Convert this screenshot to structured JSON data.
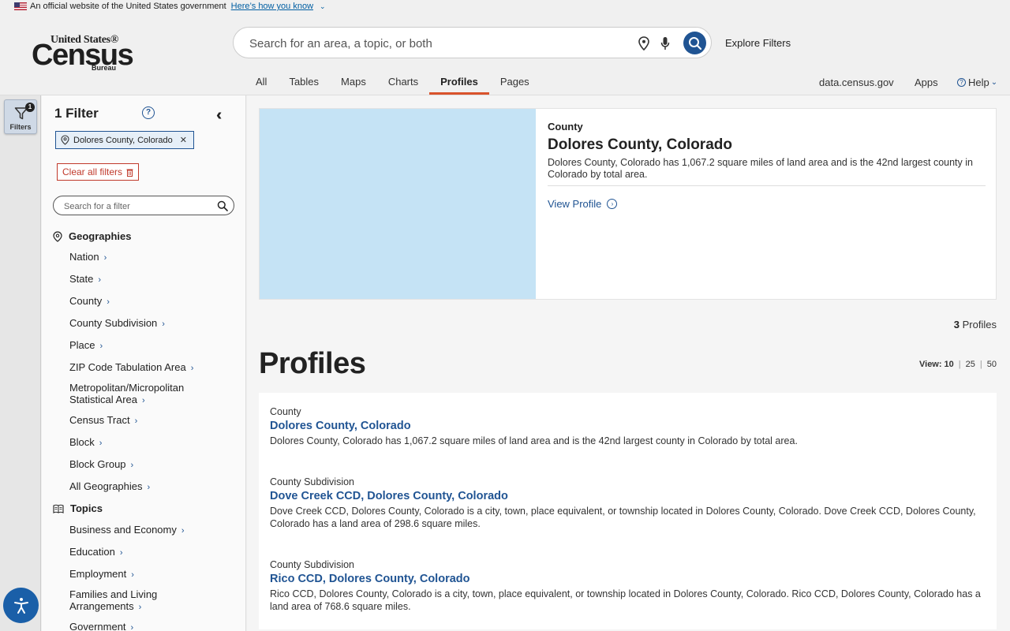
{
  "gov_banner": {
    "text": "An official website of the United States government",
    "link": "Here’s how you know"
  },
  "logo": {
    "line1": "United States®",
    "line2": "Census",
    "line3": "Bureau"
  },
  "search": {
    "placeholder": "Search for an area, a topic, or both"
  },
  "header": {
    "explore_filters": "Explore Filters",
    "tabs": [
      {
        "label": "All"
      },
      {
        "label": "Tables"
      },
      {
        "label": "Maps"
      },
      {
        "label": "Charts"
      },
      {
        "label": "Profiles"
      },
      {
        "label": "Pages"
      }
    ],
    "active_tab": "Profiles",
    "right_links": {
      "data": "data.census.gov",
      "apps": "Apps",
      "help": "Help"
    }
  },
  "rail": {
    "filters_label": "Filters",
    "badge": "1"
  },
  "filter_panel": {
    "title": "1 Filter",
    "chip": "Dolores County, Colorado",
    "clear_all": "Clear all filters",
    "search_placeholder": "Search for a filter",
    "geographies_label": "Geographies",
    "geographies": [
      "Nation",
      "State",
      "County",
      "County Subdivision",
      "Place",
      "ZIP Code Tabulation Area",
      "Metropolitan/Micropolitan Statistical Area",
      "Census Tract",
      "Block",
      "Block Group",
      "All Geographies"
    ],
    "topics_label": "Topics",
    "topics": [
      "Business and Economy",
      "Education",
      "Employment",
      "Families and Living Arrangements",
      "Government"
    ]
  },
  "feature_card": {
    "type": "County",
    "title": "Dolores County, Colorado",
    "description": "Dolores County, Colorado has 1,067.2 square miles of land area and is the 42nd largest county in Colorado by total area.",
    "link": "View Profile"
  },
  "results_header": {
    "count": "3",
    "count_label": "Profiles",
    "heading": "Profiles",
    "view_label": "View:",
    "view_options": [
      "10",
      "25",
      "50"
    ]
  },
  "results": [
    {
      "type": "County",
      "title": "Dolores County, Colorado",
      "description": "Dolores County, Colorado has 1,067.2 square miles of land area and is the 42nd largest county in Colorado by total area."
    },
    {
      "type": "County Subdivision",
      "title": "Dove Creek CCD, Dolores County, Colorado",
      "description": "Dove Creek CCD, Dolores County, Colorado is a city, town, place equivalent, or township located in Dolores County, Colorado. Dove Creek CCD, Dolores County, Colorado has a land area of 298.6 square miles."
    },
    {
      "type": "County Subdivision",
      "title": "Rico CCD, Dolores County, Colorado",
      "description": "Rico CCD, Dolores County, Colorado is a city, town, place equivalent, or township located in Dolores County, Colorado. Rico CCD, Dolores County, Colorado has a land area of 768.6 square miles."
    }
  ],
  "colors": {
    "accent": "#d9532c",
    "link": "#205493",
    "clear": "#c0392b",
    "map": "#c5e3f5"
  }
}
